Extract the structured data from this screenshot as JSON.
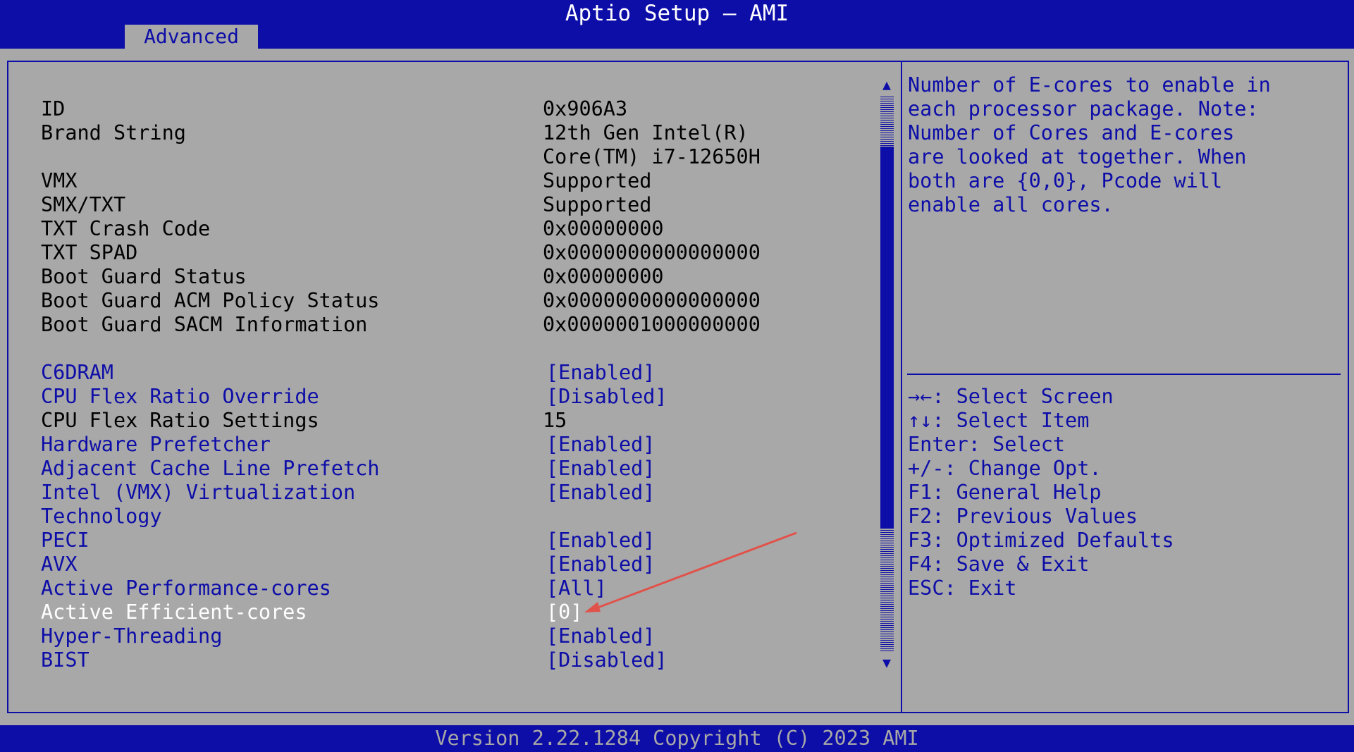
{
  "window": {
    "title": "Aptio Setup – AMI"
  },
  "tabs": [
    {
      "label": "Advanced",
      "active": true
    }
  ],
  "settings": [
    {
      "label": "ID",
      "value": "0x906A3",
      "state": "info"
    },
    {
      "label": "Brand String",
      "value": "12th Gen Intel(R)",
      "state": "info"
    },
    {
      "label": "",
      "value": "Core(TM) i7-12650H",
      "state": "info"
    },
    {
      "label": "VMX",
      "value": "Supported",
      "state": "info"
    },
    {
      "label": "SMX/TXT",
      "value": "Supported",
      "state": "info"
    },
    {
      "label": "TXT Crash Code",
      "value": "0x00000000",
      "state": "info"
    },
    {
      "label": "TXT SPAD",
      "value": "0x0000000000000000",
      "state": "info"
    },
    {
      "label": "Boot Guard Status",
      "value": "0x00000000",
      "state": "info"
    },
    {
      "label": "Boot Guard ACM Policy Status",
      "value": "0x0000000000000000",
      "state": "info"
    },
    {
      "label": "Boot Guard SACM Information",
      "value": "0x0000001000000000",
      "state": "info"
    },
    {
      "label": "C6DRAM",
      "value": "[Enabled]",
      "state": "option"
    },
    {
      "label": "CPU Flex Ratio Override",
      "value": "[Disabled]",
      "state": "option"
    },
    {
      "label": "CPU Flex Ratio Settings",
      "value": "15",
      "state": "info"
    },
    {
      "label": "Hardware Prefetcher",
      "value": "[Enabled]",
      "state": "option"
    },
    {
      "label": "Adjacent Cache Line Prefetch",
      "value": "[Enabled]",
      "state": "option"
    },
    {
      "label": "Intel (VMX) Virtualization",
      "value": "[Enabled]",
      "state": "option"
    },
    {
      "label": "Technology",
      "value": "",
      "state": "option"
    },
    {
      "label": "PECI",
      "value": "[Enabled]",
      "state": "option"
    },
    {
      "label": "AVX",
      "value": "[Enabled]",
      "state": "option"
    },
    {
      "label": "Active Performance-cores",
      "value": "[All]",
      "state": "option"
    },
    {
      "label": "Active Efficient-cores",
      "value": "[0]",
      "state": "highlighted"
    },
    {
      "label": "Hyper-Threading",
      "value": "[Enabled]",
      "state": "option"
    },
    {
      "label": "BIST",
      "value": "[Disabled]",
      "state": "option"
    }
  ],
  "help": {
    "lines": [
      "Number of E-cores to enable in",
      "each processor package. Note:",
      "Number of Cores and E-cores",
      "are looked at together. When",
      "both are {0,0}, Pcode will",
      "enable all cores."
    ]
  },
  "keys": [
    "→←: Select Screen",
    "↑↓: Select Item",
    "Enter: Select",
    "+/-: Change Opt.",
    "F1: General Help",
    "F2: Previous Values",
    "F3: Optimized Defaults",
    "F4: Save & Exit",
    "ESC: Exit"
  ],
  "scroll": {
    "up_glyph": "▲",
    "down_glyph": "▼"
  },
  "footer": {
    "text": "Version 2.22.1284 Copyright (C) 2023 AMI"
  },
  "colors": {
    "accent": "#0d0da8",
    "background": "#a8a8a8",
    "highlight_text": "#ffffff",
    "annotation_arrow": "#e0524a"
  }
}
